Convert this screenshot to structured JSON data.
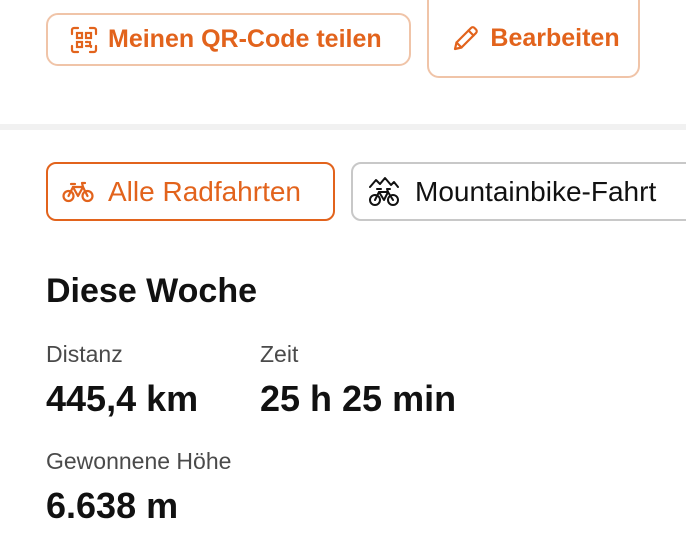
{
  "actions": {
    "qr_label": "Meinen QR-Code teilen",
    "edit_label": "Bearbeiten",
    "qr_icon": "qr-code-icon",
    "edit_icon": "pencil-icon"
  },
  "filters": {
    "all_label": "Alle Radfahrten",
    "mtb_label": "Mountainbike-Fahrt",
    "all_icon": "bicycle-icon",
    "mtb_icon": "mountain-bike-icon"
  },
  "week": {
    "title": "Diese Woche",
    "distance_label": "Distanz",
    "distance_value": "445,4 km",
    "time_label": "Zeit",
    "time_value": "25 h 25 min",
    "elevation_label": "Gewonnene Höhe",
    "elevation_value": "6.638 m"
  },
  "colors": {
    "accent": "#e2631c",
    "accent_border": "#f0c4a8",
    "neutral_border": "#c8c8c8",
    "divider": "#f1f1f1"
  }
}
